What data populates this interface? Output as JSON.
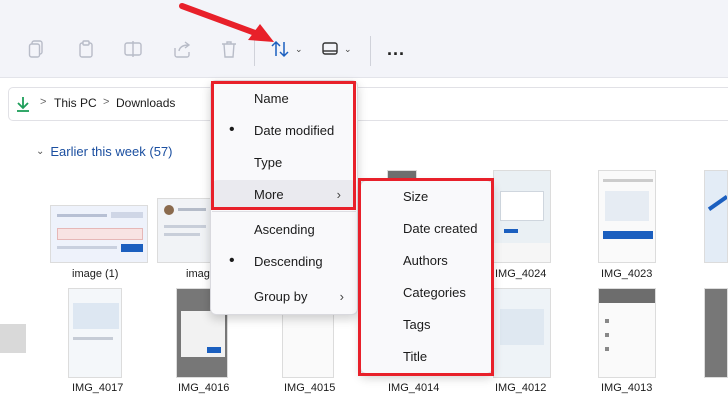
{
  "toolbar": {
    "icons": [
      "copy-icon",
      "paste-icon",
      "rename-icon",
      "share-icon",
      "delete-icon",
      "sort-icon",
      "view-icon",
      "more-icon"
    ],
    "more_label": "...",
    "chevron": "⌄"
  },
  "address_bar": {
    "crumbs": [
      "This PC",
      "Downloads"
    ],
    "separator": ">"
  },
  "group": {
    "title": "Earlier this week (57)",
    "collapse_glyph": "⌄"
  },
  "files": {
    "row1": [
      "image (1)",
      "imag",
      "IMG_4024",
      "IMG_4023"
    ],
    "row2": [
      "IMG_4017",
      "IMG_4016",
      "IMG_4015",
      "IMG_4014",
      "IMG_4012",
      "IMG_4013"
    ]
  },
  "sort_menu": {
    "items": [
      {
        "label": "Name",
        "selected": false
      },
      {
        "label": "Date modified",
        "selected": true
      },
      {
        "label": "Type",
        "selected": false
      },
      {
        "label": "More",
        "selected": false,
        "submenu": true
      }
    ],
    "order_items": [
      {
        "label": "Ascending",
        "selected": false
      },
      {
        "label": "Descending",
        "selected": true
      }
    ],
    "group_by": {
      "label": "Group by",
      "submenu": true
    },
    "bullet": "•",
    "submenu_arrow": "›"
  },
  "more_submenu": {
    "items": [
      "Size",
      "Date created",
      "Authors",
      "Categories",
      "Tags",
      "Title"
    ]
  },
  "colors": {
    "highlight": "#e8202a",
    "accent": "#1b4fa0",
    "download_green": "#1e9e5a"
  }
}
